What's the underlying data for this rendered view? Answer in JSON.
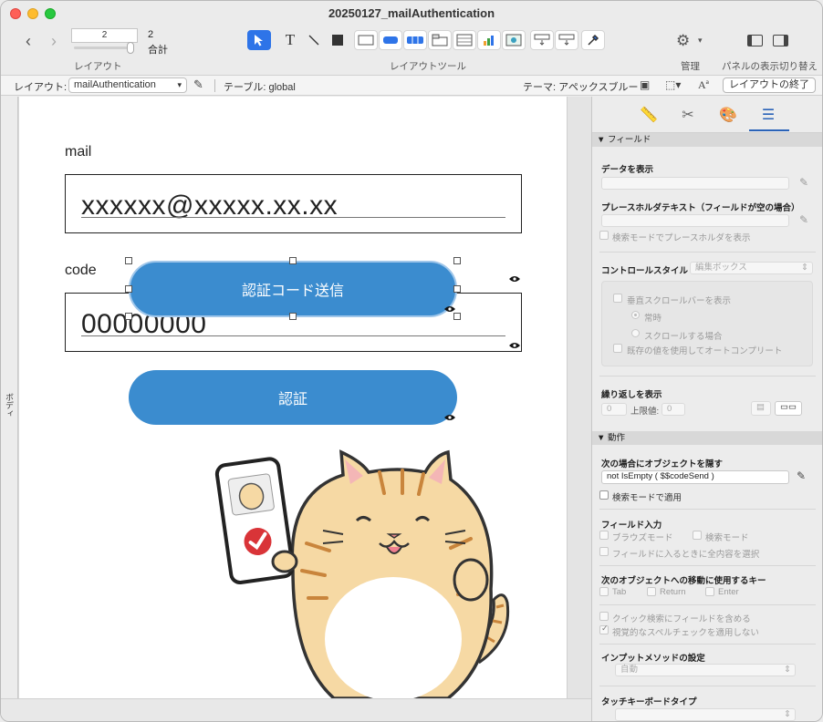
{
  "window": {
    "title": "20250127_mailAuthentication"
  },
  "toolbar": {
    "record_current": "2",
    "record_total": "2",
    "record_total_label": "合計",
    "layout_caption": "レイアウト",
    "tools_caption": "レイアウトツール",
    "manage_caption": "管理",
    "panel_caption": "パネルの表示切り替え",
    "text_tool_glyph": "T"
  },
  "layout_bar": {
    "layout_label": "レイアウト:",
    "layout_name": "mailAuthentication",
    "table": "テーブル: global",
    "theme": "テーマ: アペックスブルー",
    "exit_button": "レイアウトの終了"
  },
  "canvas": {
    "part_label": "ボディ",
    "mail_label": "mail",
    "mail_value": "xxxxxx@xxxxx.xx.xx",
    "code_label": "code",
    "code_value": "00000000",
    "send_code_button": "認証コード送信",
    "auth_button": "認証"
  },
  "inspector": {
    "section_field": "▼ フィールド",
    "display_data": "データを表示",
    "placeholder_label": "プレースホルダテキスト（フィールドが空の場合）",
    "placeholder_find": "検索モードでプレースホルダを表示",
    "control_style": "コントロールスタイル",
    "control_style_value": "編集ボックス",
    "vertical_scrollbar": "垂直スクロールバーを表示",
    "always": "常時",
    "when_scrolling": "スクロールする場合",
    "autocomplete": "既存の値を使用してオートコンプリート",
    "repeat": "繰り返しを表示",
    "repeat_from": "0",
    "repeat_max_label": "上限値:",
    "repeat_max": "0",
    "section_behavior": "▼ 動作",
    "hide_when": "次の場合にオブジェクトを隠す",
    "hide_calc": "not IsEmpty ( $$codeSend )",
    "apply_find": "検索モードで適用",
    "field_entry": "フィールド入力",
    "browse_mode": "ブラウズモード",
    "find_mode": "検索モード",
    "select_all": "フィールドに入るときに全内容を選択",
    "next_object_keys": "次のオブジェクトへの移動に使用するキー",
    "key_tab": "Tab",
    "key_return": "Return",
    "key_enter": "Enter",
    "quick_find": "クイック検索にフィールドを含める",
    "no_spellcheck": "視覚的なスペルチェックを適用しない",
    "input_method": "インプットメソッドの設定",
    "input_method_value": "自動",
    "touch_keyboard": "タッチキーボードタイプ"
  }
}
